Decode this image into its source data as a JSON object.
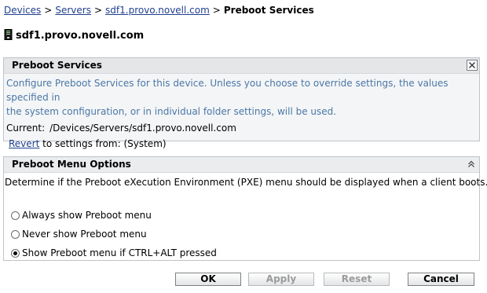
{
  "breadcrumb": {
    "items": [
      "Devices",
      "Servers",
      "sdf1.provo.novell.com"
    ],
    "current": "Preboot Services",
    "separator": ">"
  },
  "device": {
    "name": "sdf1.provo.novell.com",
    "icon": "server-icon"
  },
  "preboot_panel": {
    "title": "Preboot Services",
    "description_line1": "Configure Preboot Services for this device. Unless you choose to override settings, the values specified in",
    "description_line2": "the system configuration, or in individual folder settings, will be used.",
    "current_label": "Current:",
    "current_path": "/Devices/Servers/sdf1.provo.novell.com",
    "revert_link": "Revert",
    "revert_text": "to settings from: (System)"
  },
  "menu_panel": {
    "title": "Preboot Menu Options",
    "description": "Determine if the Preboot eXecution Environment (PXE) menu should be displayed when a client boots.",
    "options": [
      {
        "label": "Always show Preboot menu",
        "selected": false
      },
      {
        "label": "Never show Preboot menu",
        "selected": false
      },
      {
        "label": "Show Preboot menu if CTRL+ALT pressed",
        "selected": true
      }
    ]
  },
  "buttons": {
    "ok": "OK",
    "apply": "Apply",
    "reset": "Reset",
    "cancel": "Cancel"
  },
  "colors": {
    "link": "#1f3f8f",
    "description": "#4a77a8",
    "disabled": "#9b9b9b"
  }
}
